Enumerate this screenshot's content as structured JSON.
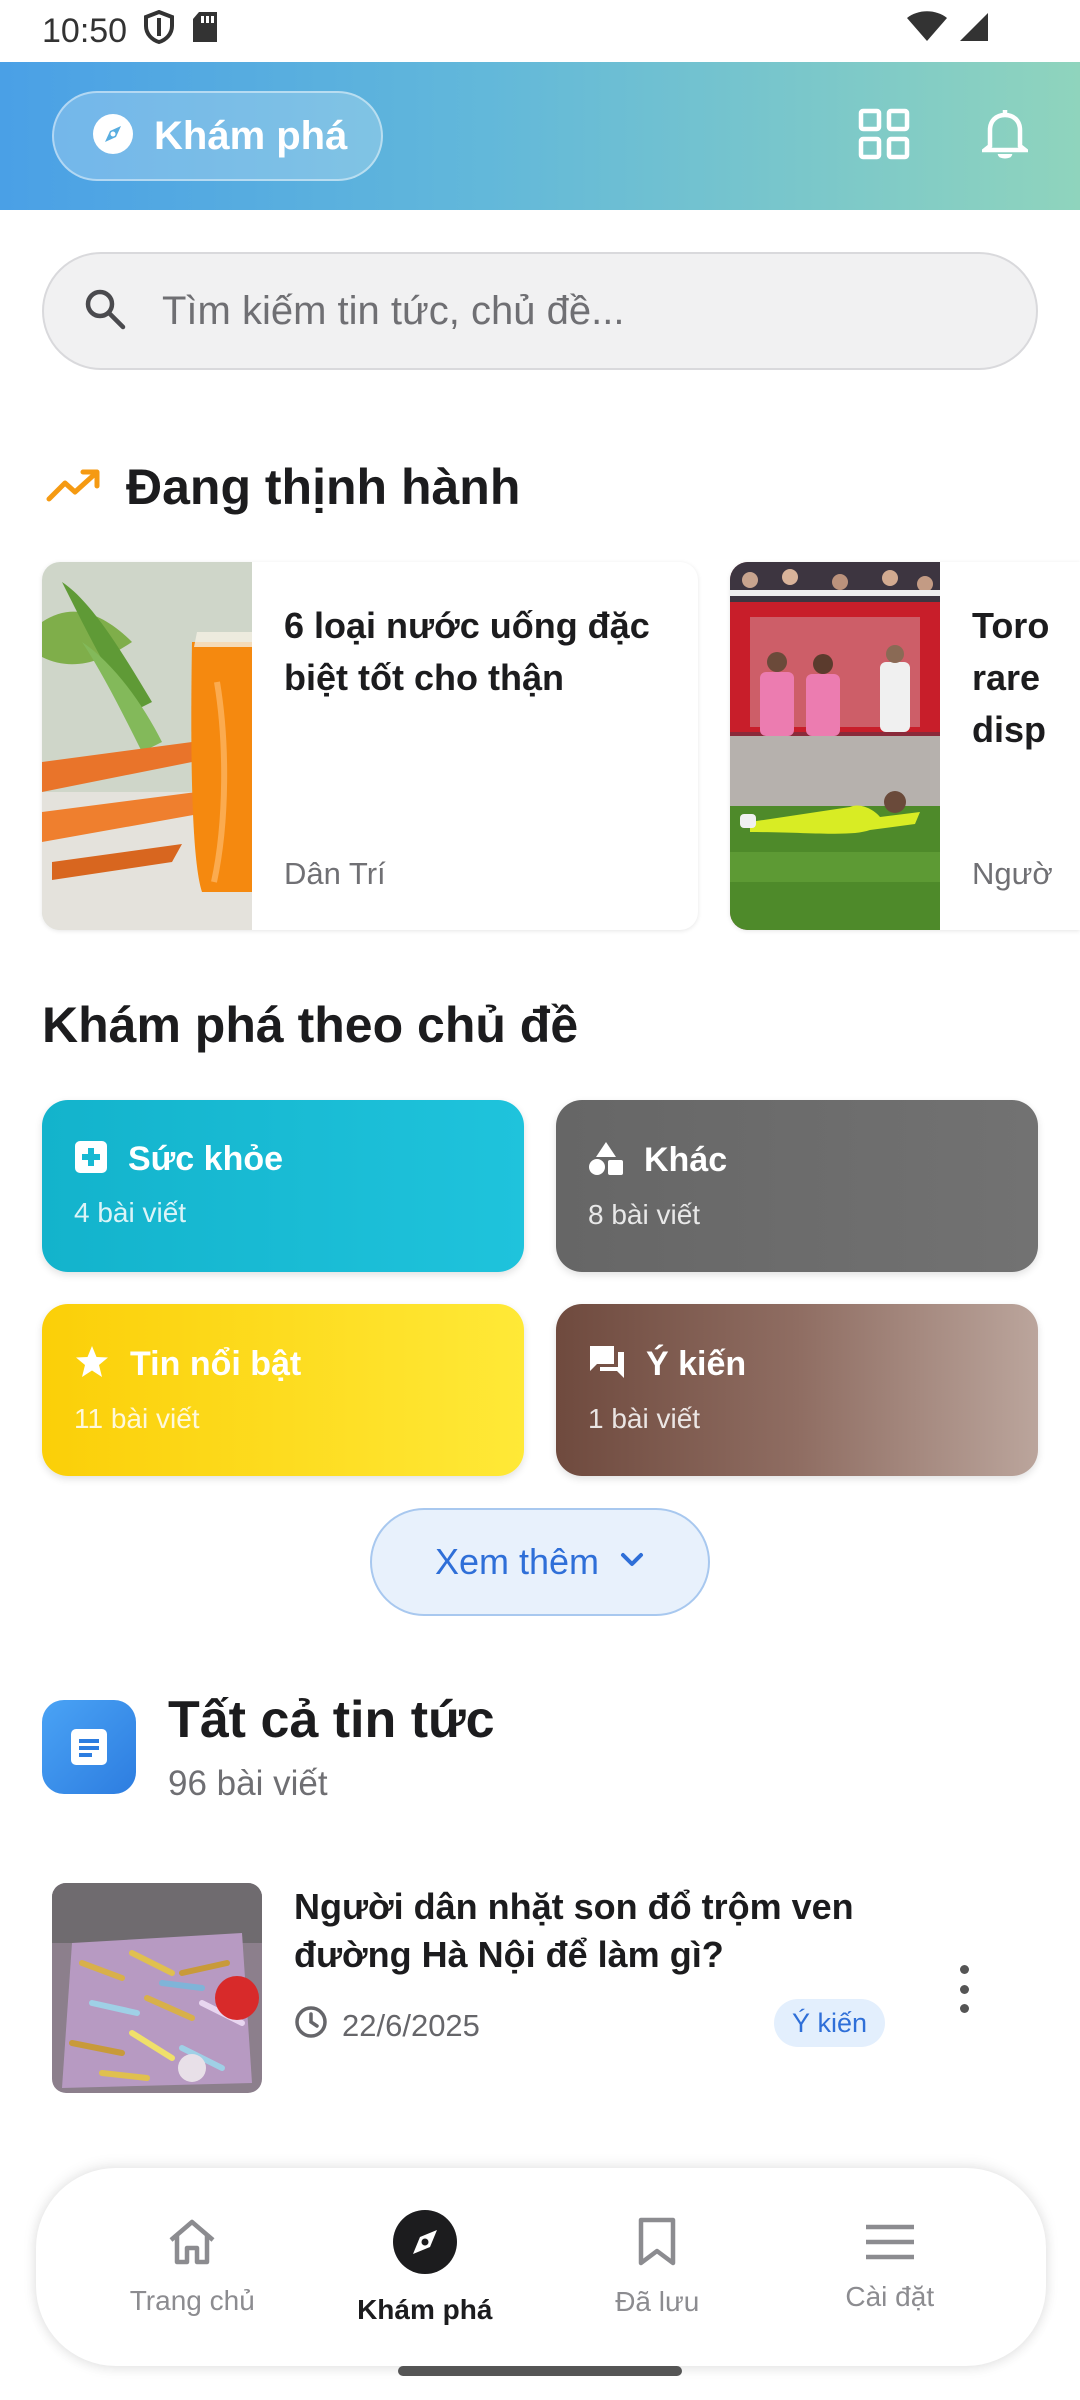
{
  "status_bar": {
    "time": "10:50"
  },
  "header": {
    "explore_label": "Khám phá"
  },
  "search": {
    "placeholder": "Tìm kiếm tin tức, chủ đề..."
  },
  "trending": {
    "title": "Đang thịnh hành",
    "cards": [
      {
        "title": "6 loại nước uống đặc\nbiệt tốt cho thận",
        "source": "Dân Trí"
      },
      {
        "title": "Toro\nrare\ndisp",
        "source": "Ngườ"
      }
    ]
  },
  "categories": {
    "title": "Khám phá theo chủ đề",
    "items": [
      {
        "name": "Sức khỏe",
        "count": "4 bài viết",
        "icon": "medical-plus-icon",
        "color": "#17b9d3"
      },
      {
        "name": "Khác",
        "count": "8 bài viết",
        "icon": "shapes-icon",
        "color": "#6d6d6d"
      },
      {
        "name": "Tin nổi bật",
        "count": "11 bài viết",
        "icon": "star-icon",
        "color": "#fcd412"
      },
      {
        "name": "Ý kiến",
        "count": "1 bài viết",
        "icon": "forum-icon",
        "color": "#7e5a4e"
      }
    ],
    "more_label": "Xem thêm"
  },
  "all_news": {
    "title": "Tất cả tin tức",
    "count": "96 bài viết",
    "articles": [
      {
        "title": "Người dân nhặt son đổ trộm ven\nđường Hà Nội để làm gì?",
        "date": "22/6/2025",
        "tag": "Ý kiến"
      }
    ]
  },
  "bottom_nav": {
    "items": [
      {
        "label": "Trang chủ",
        "icon": "home-icon"
      },
      {
        "label": "Khám phá",
        "icon": "compass-icon",
        "active": true
      },
      {
        "label": "Đã lưu",
        "icon": "bookmark-icon"
      },
      {
        "label": "Cài đặt",
        "icon": "menu-icon"
      }
    ]
  },
  "colors": {
    "accent": "#2f6fd8",
    "trending_orange": "#f59a12"
  }
}
